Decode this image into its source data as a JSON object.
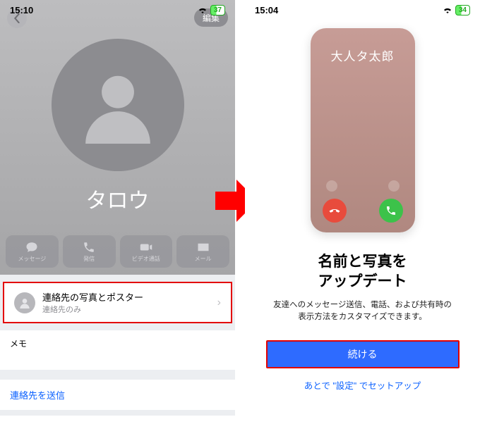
{
  "left": {
    "status": {
      "time": "15:10",
      "battery": "37"
    },
    "edit_label": "編集",
    "contact_name": "タロウ",
    "actions": {
      "message": "メッセージ",
      "call": "発信",
      "video": "ビデオ通話",
      "mail": "メール"
    },
    "poster_row": {
      "title": "連絡先の写真とポスター",
      "subtitle": "連絡先のみ"
    },
    "memo_label": "メモ",
    "send_contact": "連絡先を送信"
  },
  "right": {
    "status": {
      "time": "15:04",
      "battery": "34"
    },
    "poster_name": "大人タ太郎",
    "headline_l1": "名前と写真を",
    "headline_l2": "アップデート",
    "description_l1": "友達へのメッセージ送信、電話、および共有時の",
    "description_l2": "表示方法をカスタマイズできます。",
    "continue_label": "続ける",
    "later_label": "あとで \"設定\" でセットアップ"
  }
}
